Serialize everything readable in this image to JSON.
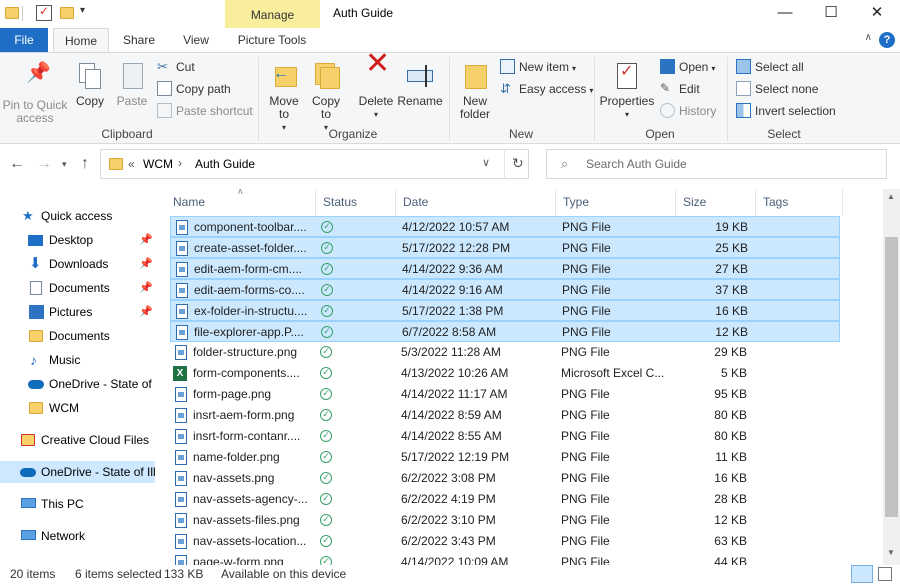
{
  "titlebar": {
    "manage_label": "Manage",
    "title": "Auth Guide",
    "minimize": "—",
    "maximize": "☐",
    "close": "✕"
  },
  "tabs": {
    "file": "File",
    "home": "Home",
    "share": "Share",
    "view": "View",
    "picture_tools": "Picture Tools",
    "help": "?"
  },
  "ribbon": {
    "clipboard": {
      "pin": "Pin to Quick access",
      "copy": "Copy",
      "paste": "Paste",
      "cut": "Cut",
      "copy_path": "Copy path",
      "paste_shortcut": "Paste shortcut",
      "label": "Clipboard"
    },
    "organize": {
      "move_to": "Move to",
      "copy_to": "Copy to",
      "delete": "Delete",
      "rename": "Rename",
      "label": "Organize"
    },
    "new": {
      "new_folder": "New folder",
      "new_item": "New item",
      "easy_access": "Easy access",
      "label": "New"
    },
    "open": {
      "properties": "Properties",
      "open": "Open",
      "edit": "Edit",
      "history": "History",
      "label": "Open"
    },
    "select": {
      "select_all": "Select all",
      "select_none": "Select none",
      "invert": "Invert selection",
      "label": "Select"
    }
  },
  "address": {
    "path_prefix": "«",
    "segment1": "WCM",
    "segment2": "Auth Guide",
    "search_placeholder": "Search Auth Guide"
  },
  "nav": {
    "quick_access": "Quick access",
    "desktop": "Desktop",
    "downloads": "Downloads",
    "documents": "Documents",
    "pictures": "Pictures",
    "documents2": "Documents",
    "music": "Music",
    "onedrive_state": "OneDrive - State of",
    "wcm": "WCM",
    "creative_cloud": "Creative Cloud Files",
    "onedrive_selected": "OneDrive - State of Ill",
    "this_pc": "This PC",
    "network": "Network"
  },
  "columns": {
    "name": "Name",
    "status": "Status",
    "date": "Date",
    "type": "Type",
    "size": "Size",
    "tags": "Tags"
  },
  "files": [
    {
      "name": "component-toolbar....",
      "date": "4/12/2022 10:57 AM",
      "type": "PNG File",
      "size": "19 KB",
      "selected": true
    },
    {
      "name": "create-asset-folder....",
      "date": "5/17/2022 12:28 PM",
      "type": "PNG File",
      "size": "25 KB",
      "selected": true
    },
    {
      "name": "edit-aem-form-cm....",
      "date": "4/14/2022 9:36 AM",
      "type": "PNG File",
      "size": "27 KB",
      "selected": true
    },
    {
      "name": "edit-aem-forms-co....",
      "date": "4/14/2022 9:16 AM",
      "type": "PNG File",
      "size": "37 KB",
      "selected": true
    },
    {
      "name": "ex-folder-in-structu....",
      "date": "5/17/2022 1:38 PM",
      "type": "PNG File",
      "size": "16 KB",
      "selected": true
    },
    {
      "name": "file-explorer-app.P....",
      "date": "6/7/2022 8:58 AM",
      "type": "PNG File",
      "size": "12 KB",
      "selected": true
    },
    {
      "name": "folder-structure.png",
      "date": "5/3/2022 11:28 AM",
      "type": "PNG File",
      "size": "29 KB",
      "selected": false
    },
    {
      "name": "form-components....",
      "date": "4/13/2022 10:26 AM",
      "type": "Microsoft Excel C...",
      "size": "5 KB",
      "selected": false,
      "excel": true
    },
    {
      "name": "form-page.png",
      "date": "4/14/2022 11:17 AM",
      "type": "PNG File",
      "size": "95 KB",
      "selected": false
    },
    {
      "name": "insrt-aem-form.png",
      "date": "4/14/2022 8:59 AM",
      "type": "PNG File",
      "size": "80 KB",
      "selected": false
    },
    {
      "name": "insrt-form-contanr....",
      "date": "4/14/2022 8:55 AM",
      "type": "PNG File",
      "size": "80 KB",
      "selected": false
    },
    {
      "name": "name-folder.png",
      "date": "5/17/2022 12:19 PM",
      "type": "PNG File",
      "size": "11 KB",
      "selected": false
    },
    {
      "name": "nav-assets.png",
      "date": "6/2/2022 3:08 PM",
      "type": "PNG File",
      "size": "16 KB",
      "selected": false
    },
    {
      "name": "nav-assets-agency-...",
      "date": "6/2/2022 4:19 PM",
      "type": "PNG File",
      "size": "28 KB",
      "selected": false
    },
    {
      "name": "nav-assets-files.png",
      "date": "6/2/2022 3:10 PM",
      "type": "PNG File",
      "size": "12 KB",
      "selected": false
    },
    {
      "name": "nav-assets-location...",
      "date": "6/2/2022 3:43 PM",
      "type": "PNG File",
      "size": "63 KB",
      "selected": false
    },
    {
      "name": "page-w-form.png",
      "date": "4/14/2022 10:09 AM",
      "type": "PNG File",
      "size": "44 KB",
      "selected": false
    }
  ],
  "status": {
    "items": "20 items",
    "selected": "6 items selected",
    "size": "133 KB",
    "availability": "Available on this device"
  },
  "colors": {
    "accent": "#1f6ec5",
    "manage": "#f8ee9c",
    "selection": "#cce8ff"
  }
}
